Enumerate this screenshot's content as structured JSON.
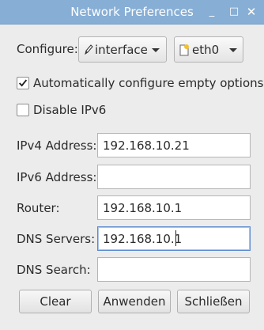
{
  "window": {
    "title": "Network Preferences",
    "controls": {
      "minimize": "_",
      "maximize": "□",
      "close": "✕"
    }
  },
  "configure": {
    "label": "Configure:",
    "type_value": "interface",
    "interface_value": "eth0"
  },
  "options": {
    "auto_configure": {
      "label": "Automatically configure empty options",
      "checked": true
    },
    "disable_ipv6": {
      "label": "Disable IPv6",
      "checked": false
    }
  },
  "fields": {
    "ipv4": {
      "label": "IPv4 Address:",
      "value": "192.168.10.21"
    },
    "ipv6": {
      "label": "IPv6 Address:",
      "value": ""
    },
    "router": {
      "label": "Router:",
      "value": "192.168.10.1"
    },
    "dns_servers": {
      "label": "DNS Servers:",
      "value": "192.168.10.1"
    },
    "dns_search": {
      "label": "DNS Search:",
      "value": ""
    }
  },
  "buttons": {
    "clear": "Clear",
    "apply": "Anwenden",
    "close": "Schließen"
  },
  "colors": {
    "titlebar": "#87aed5",
    "window_bg": "#ececec",
    "focus_border": "#5b8bd0"
  }
}
